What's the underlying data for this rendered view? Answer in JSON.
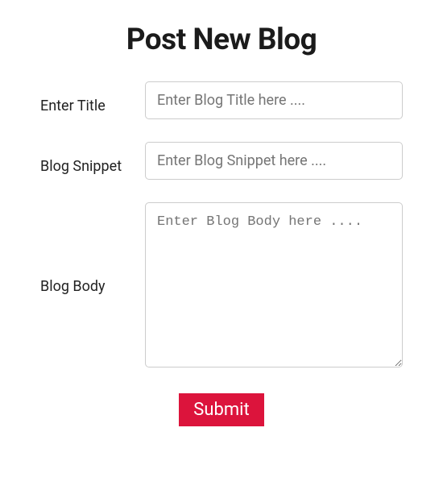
{
  "page": {
    "title": "Post New Blog"
  },
  "form": {
    "title_label": "Enter Title",
    "title_placeholder": "Enter Blog Title here ....",
    "title_value": "",
    "snippet_label": "Blog Snippet",
    "snippet_placeholder": "Enter Blog Snippet here ....",
    "snippet_value": "",
    "body_label": "Blog Body",
    "body_placeholder": "Enter Blog Body here ....",
    "body_value": "",
    "submit_label": "Submit"
  }
}
